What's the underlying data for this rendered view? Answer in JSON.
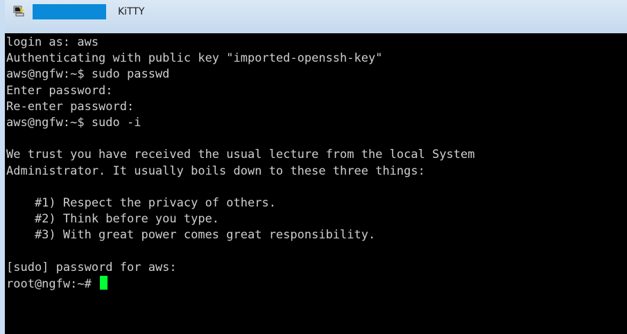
{
  "window": {
    "title": "KiTTY",
    "icon": "putty-terminal-icon",
    "colors": {
      "titlebar": "#c9def2",
      "redaction": "#0a8ad8",
      "terminal_bg": "#000000",
      "terminal_fg": "#cfcfcf",
      "cursor": "#00ff33"
    }
  },
  "terminal": {
    "lines": [
      "login as: aws",
      "Authenticating with public key \"imported-openssh-key\"",
      "aws@ngfw:~$ sudo passwd",
      "Enter password:",
      "Re-enter password:",
      "aws@ngfw:~$ sudo -i",
      "",
      "We trust you have received the usual lecture from the local System",
      "Administrator. It usually boils down to these three things:",
      "",
      "    #1) Respect the privacy of others.",
      "    #2) Think before you type.",
      "    #3) With great power comes great responsibility.",
      "",
      "[sudo] password for aws:"
    ],
    "prompt": "root@ngfw:~# "
  }
}
